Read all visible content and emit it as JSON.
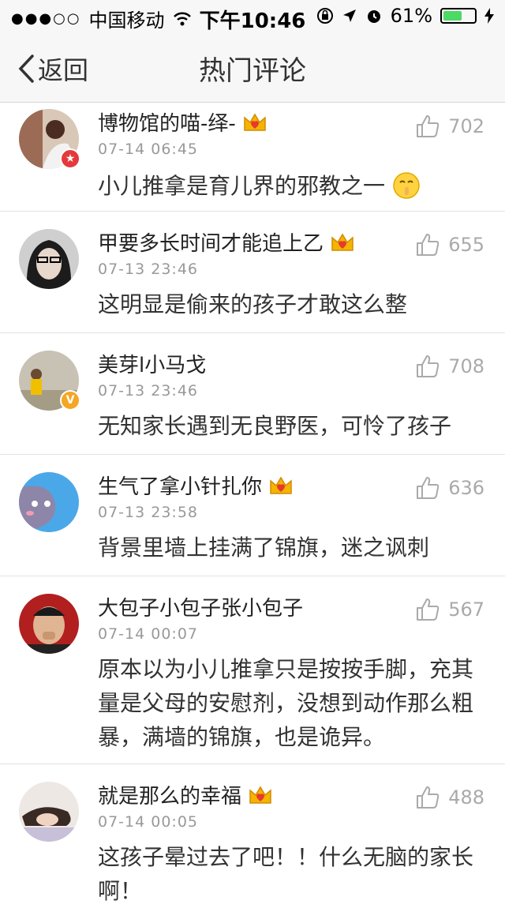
{
  "status_bar": {
    "signal_dots": "●●●○○",
    "carrier": "中国移动",
    "time": "下午10:46",
    "battery_percent": "61%",
    "battery_level": 0.61,
    "battery_color": "#4cd964"
  },
  "nav": {
    "back_label": "返回",
    "title": "热门评论"
  },
  "comments": [
    {
      "name": "博物馆的喵-绎-",
      "vip": true,
      "badge": "red",
      "time": "07-14 06:45",
      "likes": "702",
      "text": "小儿推拿是育儿界的邪教之一"
    },
    {
      "name": "甲要多长时间才能追上乙",
      "vip": true,
      "badge": "",
      "time": "07-13 23:46",
      "likes": "655",
      "text": "这明显是偷来的孩子才敢这么整"
    },
    {
      "name": "美芽l小马戈",
      "vip": false,
      "badge": "V",
      "time": "07-13 23:46",
      "likes": "708",
      "text": "无知家长遇到无良野医，可怜了孩子"
    },
    {
      "name": "生气了拿小针扎你",
      "vip": true,
      "badge": "",
      "time": "07-13 23:58",
      "likes": "636",
      "text": "背景里墙上挂满了锦旗，迷之讽刺"
    },
    {
      "name": "大包子小包子张小包子",
      "vip": false,
      "badge": "",
      "time": "07-14 00:07",
      "likes": "567",
      "text": "原本以为小儿推拿只是按按手脚，充其量是父母的安慰剂，没想到动作那么粗暴，满墙的锦旗，也是诡异。"
    },
    {
      "name": "就是那么的幸福",
      "vip": true,
      "badge": "",
      "time": "07-14 00:05",
      "likes": "488",
      "text": "这孩子晕过去了吧！！什么无脑的家长啊！"
    }
  ]
}
